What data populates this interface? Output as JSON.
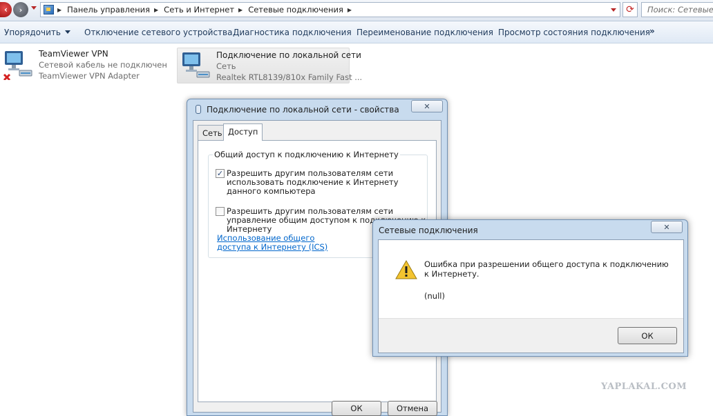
{
  "address_bar": {
    "crumbs": [
      "Панель управления",
      "Сеть и Интернет",
      "Сетевые подключения"
    ],
    "search_placeholder": "Поиск: Сетевые подключения"
  },
  "command_bar": {
    "organize": "Упорядочить",
    "disable": "Отключение сетевого устройства",
    "diagnose": "Диагностика подключения",
    "rename": "Переименование подключения",
    "status": "Просмотр состояния подключения",
    "more": "»"
  },
  "connections": [
    {
      "name": "TeamViewer VPN",
      "status": "Сетевой кабель не подключен",
      "adapter": "TeamViewer VPN Adapter",
      "disconnected": true
    },
    {
      "name": "Подключение по локальной сети",
      "status": "Сеть",
      "adapter": "Realtek RTL8139/810x Family Fast ...",
      "disconnected": false
    }
  ],
  "properties_dialog": {
    "title": "Подключение по локальной сети - свойства",
    "close": "✕",
    "tabs": [
      "Сеть",
      "Доступ"
    ],
    "active_tab": "Доступ",
    "group_title": "Общий доступ к подключению к Интернету",
    "checkbox1_label": "Разрешить другим пользователям сети использовать подключение к Интернету данного компьютера",
    "checkbox1_checked": true,
    "checkbox2_label": "Разрешить другим пользователям сети управление общим доступом к подключению к Интернету",
    "checkbox2_checked": false,
    "ics_link": "Использование общего доступа к Интернету (ICS)",
    "ok_label": "ОК",
    "cancel_label": "Отмена"
  },
  "error_dialog": {
    "title": "Сетевые подключения",
    "close": "✕",
    "message": "Ошибка при разрешении общего доступа к подключению к Интернету.",
    "detail": "(null)",
    "ok_label": "ОК"
  },
  "watermark": "YAPLAKAL.COM"
}
